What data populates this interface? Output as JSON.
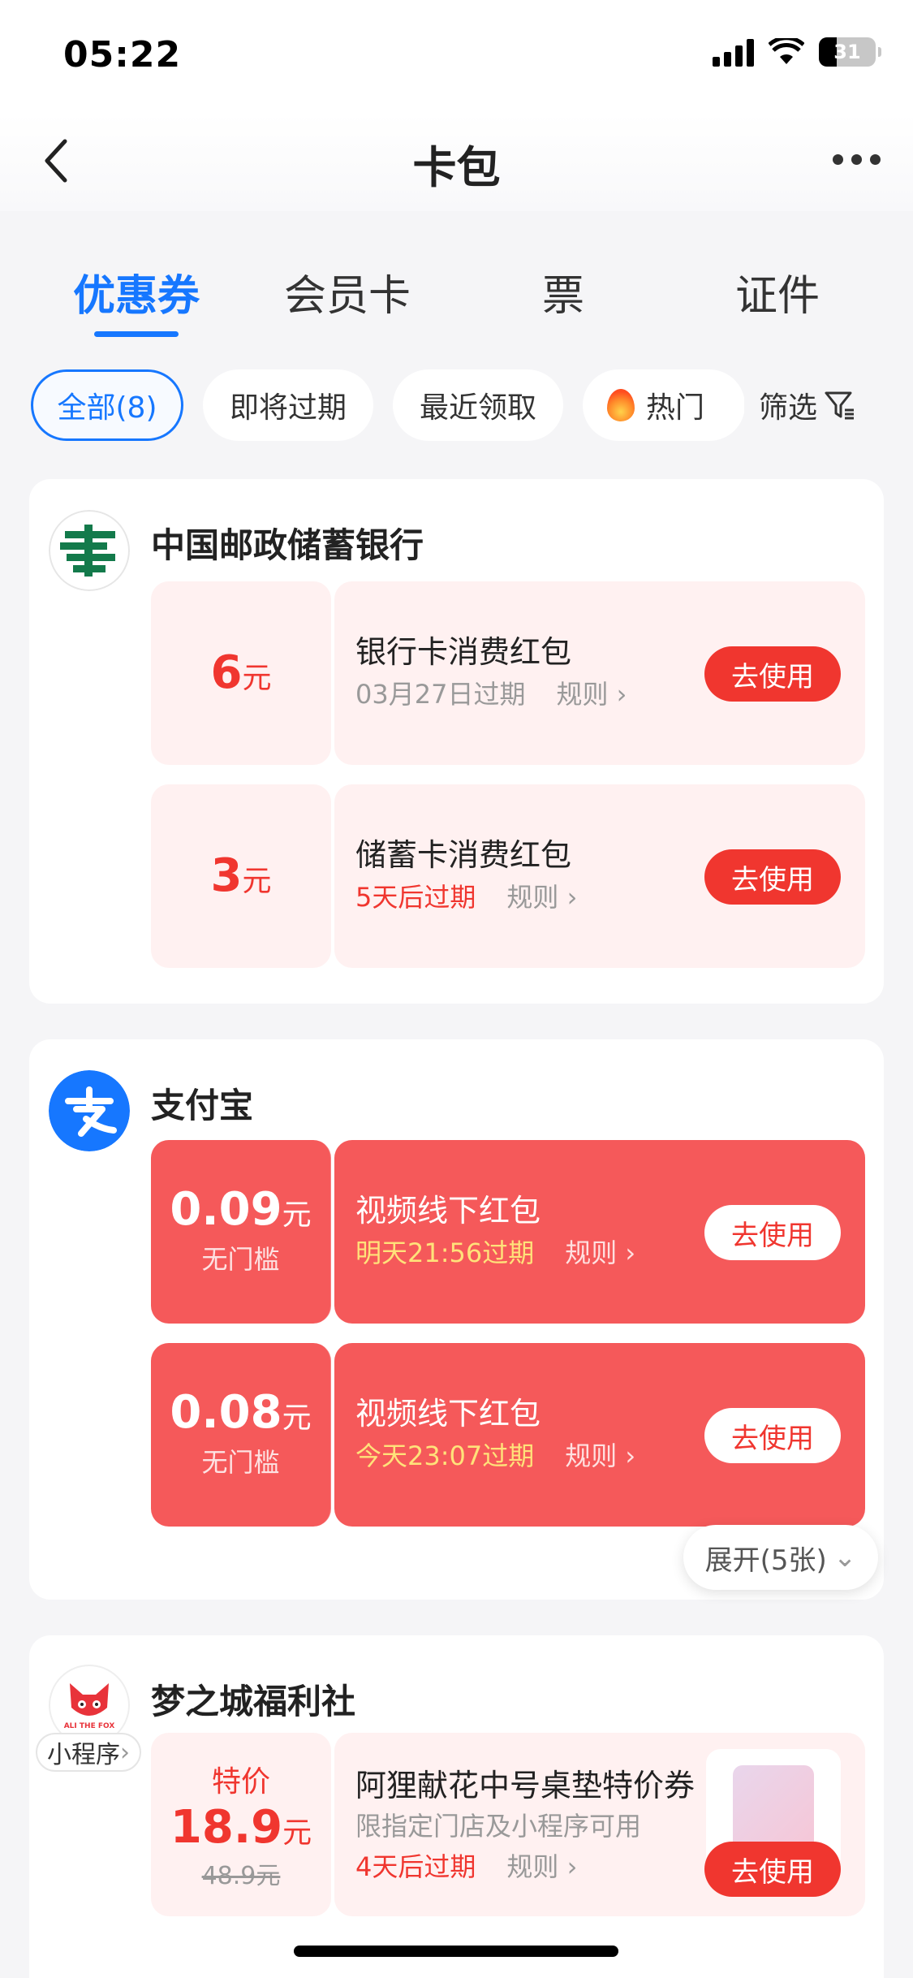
{
  "status": {
    "time": "05:22",
    "battery": "31"
  },
  "nav": {
    "title": "卡包"
  },
  "tabs": [
    "优惠券",
    "会员卡",
    "票",
    "证件"
  ],
  "chips": {
    "all": "全部(8)",
    "expiring": "即将过期",
    "recent": "最近领取",
    "hot": "热门",
    "filter": "筛选"
  },
  "brands": {
    "postal": {
      "name": "中国邮政储蓄银行",
      "coupons": [
        {
          "amount": "6",
          "unit": "元",
          "title": "银行卡消费红包",
          "expiry": "03月27日过期",
          "rule": "规则",
          "action": "去使用"
        },
        {
          "amount": "3",
          "unit": "元",
          "title": "储蓄卡消费红包",
          "expiry": "5天后过期",
          "rule": "规则",
          "action": "去使用"
        }
      ]
    },
    "alipay": {
      "name": "支付宝",
      "coupons": [
        {
          "amount": "0.09",
          "unit": "元",
          "threshold": "无门槛",
          "title": "视频线下红包",
          "expiry": "明天21:56过期",
          "rule": "规则",
          "action": "去使用"
        },
        {
          "amount": "0.08",
          "unit": "元",
          "threshold": "无门槛",
          "title": "视频线下红包",
          "expiry": "今天23:07过期",
          "rule": "规则",
          "action": "去使用"
        }
      ],
      "expand": "展开(5张)"
    },
    "dream": {
      "name": "梦之城福利社",
      "badge": "小程序",
      "logo_text": "ALI THE FOX",
      "coupon": {
        "label": "特价",
        "price": "18.9",
        "unit": "元",
        "original": "48.9元",
        "title": "阿狸献花中号桌垫特价券",
        "desc": "限指定门店及小程序可用",
        "expiry": "4天后过期",
        "rule": "规则",
        "action": "去使用"
      }
    }
  },
  "colors": {
    "accent": "#1677ff",
    "red": "#f0362f",
    "coupon_red": "#f5595a",
    "coupon_pink": "#fff1f1"
  }
}
